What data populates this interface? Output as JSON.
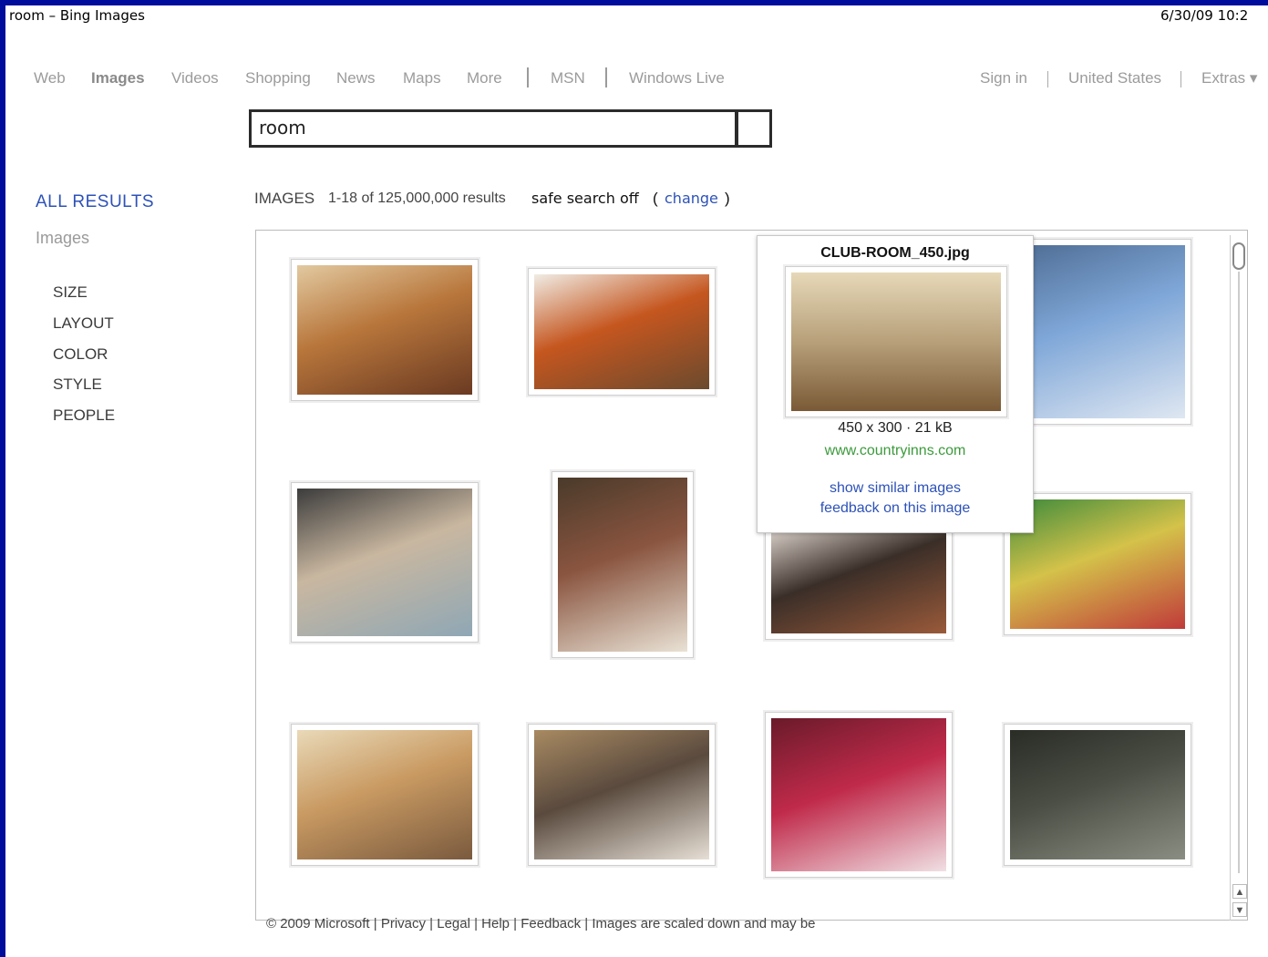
{
  "window": {
    "title": "room – Bing Images",
    "datetime": "6/30/09 10:2"
  },
  "nav": {
    "items": [
      "Web",
      "Images",
      "Videos",
      "Shopping",
      "News",
      "Maps",
      "More"
    ],
    "msn": "MSN",
    "windows_live": "Windows Live",
    "sign_in": "Sign in",
    "region": "United States",
    "extras": "Extras ▾"
  },
  "search": {
    "query": "room"
  },
  "sidebar": {
    "all_results": "ALL RESULTS",
    "images": "Images",
    "filters": [
      "SIZE",
      "LAYOUT",
      "COLOR",
      "STYLE",
      "PEOPLE"
    ]
  },
  "results": {
    "label": "IMAGES",
    "count": "1-18 of 125,000,000 results",
    "safe": "safe search off",
    "paren_open": "(",
    "change": "change",
    "paren_close": ")"
  },
  "popup": {
    "filename": "CLUB-ROOM_450.jpg",
    "dims": "450 x 300 · 21 kB",
    "domain": "www.countryinns.com",
    "similar": "show similar images",
    "feedback": "feedback on this image"
  },
  "images": [
    {
      "name": "bedroom-attic-photo",
      "colors": [
        "#b8763b",
        "#6a3a22",
        "#e2c9a0"
      ]
    },
    {
      "name": "hotel-room-orange-wall",
      "colors": [
        "#c5561f",
        "#6b4a2e",
        "#f0ece4"
      ]
    },
    {
      "name": "club-room",
      "colors": [
        "#b7a07a",
        "#7a5a36",
        "#e6d8b8"
      ]
    },
    {
      "name": "blue-bathroom",
      "colors": [
        "#7fa7d8",
        "#dfe7f2",
        "#4d6b92"
      ]
    },
    {
      "name": "bathroom-render",
      "colors": [
        "#c9b7a0",
        "#8fa7b5",
        "#3c3c3c"
      ]
    },
    {
      "name": "bedroom-ceiling-fan",
      "colors": [
        "#8a5540",
        "#e9e2d5",
        "#4a3a2a"
      ]
    },
    {
      "name": "dark-hotel-room",
      "colors": [
        "#3a2e28",
        "#9a5a3a",
        "#e8e0d8"
      ]
    },
    {
      "name": "colorful-bedroom",
      "colors": [
        "#d4c24a",
        "#c03a3a",
        "#3c8a3c"
      ]
    },
    {
      "name": "cabin-bedroom",
      "colors": [
        "#c99a62",
        "#7a5a3e",
        "#e9d9b8"
      ]
    },
    {
      "name": "hotel-bed-lights",
      "colors": [
        "#5a4a3e",
        "#e6dfd5",
        "#a88a62"
      ]
    },
    {
      "name": "pink-dining-room",
      "colors": [
        "#c02a4a",
        "#f0e0e4",
        "#6a1a2a"
      ]
    },
    {
      "name": "abandoned-room",
      "colors": [
        "#4a4e44",
        "#8a8e82",
        "#2a2c26"
      ]
    }
  ],
  "footer": "© 2009 Microsoft  |  Privacy  |  Legal  |  Help  |  Feedback  | Images are scaled down and may be"
}
